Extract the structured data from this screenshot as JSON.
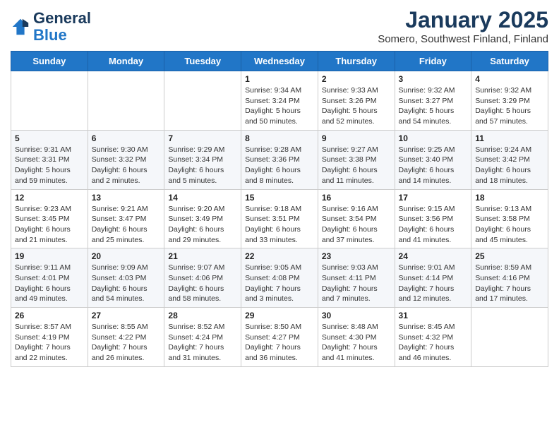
{
  "header": {
    "logo_general": "General",
    "logo_blue": "Blue",
    "title": "January 2025",
    "subtitle": "Somero, Southwest Finland, Finland"
  },
  "weekdays": [
    "Sunday",
    "Monday",
    "Tuesday",
    "Wednesday",
    "Thursday",
    "Friday",
    "Saturday"
  ],
  "weeks": [
    [
      {
        "day": "",
        "info": ""
      },
      {
        "day": "",
        "info": ""
      },
      {
        "day": "",
        "info": ""
      },
      {
        "day": "1",
        "info": "Sunrise: 9:34 AM\nSunset: 3:24 PM\nDaylight: 5 hours\nand 50 minutes."
      },
      {
        "day": "2",
        "info": "Sunrise: 9:33 AM\nSunset: 3:26 PM\nDaylight: 5 hours\nand 52 minutes."
      },
      {
        "day": "3",
        "info": "Sunrise: 9:32 AM\nSunset: 3:27 PM\nDaylight: 5 hours\nand 54 minutes."
      },
      {
        "day": "4",
        "info": "Sunrise: 9:32 AM\nSunset: 3:29 PM\nDaylight: 5 hours\nand 57 minutes."
      }
    ],
    [
      {
        "day": "5",
        "info": "Sunrise: 9:31 AM\nSunset: 3:31 PM\nDaylight: 5 hours\nand 59 minutes."
      },
      {
        "day": "6",
        "info": "Sunrise: 9:30 AM\nSunset: 3:32 PM\nDaylight: 6 hours\nand 2 minutes."
      },
      {
        "day": "7",
        "info": "Sunrise: 9:29 AM\nSunset: 3:34 PM\nDaylight: 6 hours\nand 5 minutes."
      },
      {
        "day": "8",
        "info": "Sunrise: 9:28 AM\nSunset: 3:36 PM\nDaylight: 6 hours\nand 8 minutes."
      },
      {
        "day": "9",
        "info": "Sunrise: 9:27 AM\nSunset: 3:38 PM\nDaylight: 6 hours\nand 11 minutes."
      },
      {
        "day": "10",
        "info": "Sunrise: 9:25 AM\nSunset: 3:40 PM\nDaylight: 6 hours\nand 14 minutes."
      },
      {
        "day": "11",
        "info": "Sunrise: 9:24 AM\nSunset: 3:42 PM\nDaylight: 6 hours\nand 18 minutes."
      }
    ],
    [
      {
        "day": "12",
        "info": "Sunrise: 9:23 AM\nSunset: 3:45 PM\nDaylight: 6 hours\nand 21 minutes."
      },
      {
        "day": "13",
        "info": "Sunrise: 9:21 AM\nSunset: 3:47 PM\nDaylight: 6 hours\nand 25 minutes."
      },
      {
        "day": "14",
        "info": "Sunrise: 9:20 AM\nSunset: 3:49 PM\nDaylight: 6 hours\nand 29 minutes."
      },
      {
        "day": "15",
        "info": "Sunrise: 9:18 AM\nSunset: 3:51 PM\nDaylight: 6 hours\nand 33 minutes."
      },
      {
        "day": "16",
        "info": "Sunrise: 9:16 AM\nSunset: 3:54 PM\nDaylight: 6 hours\nand 37 minutes."
      },
      {
        "day": "17",
        "info": "Sunrise: 9:15 AM\nSunset: 3:56 PM\nDaylight: 6 hours\nand 41 minutes."
      },
      {
        "day": "18",
        "info": "Sunrise: 9:13 AM\nSunset: 3:58 PM\nDaylight: 6 hours\nand 45 minutes."
      }
    ],
    [
      {
        "day": "19",
        "info": "Sunrise: 9:11 AM\nSunset: 4:01 PM\nDaylight: 6 hours\nand 49 minutes."
      },
      {
        "day": "20",
        "info": "Sunrise: 9:09 AM\nSunset: 4:03 PM\nDaylight: 6 hours\nand 54 minutes."
      },
      {
        "day": "21",
        "info": "Sunrise: 9:07 AM\nSunset: 4:06 PM\nDaylight: 6 hours\nand 58 minutes."
      },
      {
        "day": "22",
        "info": "Sunrise: 9:05 AM\nSunset: 4:08 PM\nDaylight: 7 hours\nand 3 minutes."
      },
      {
        "day": "23",
        "info": "Sunrise: 9:03 AM\nSunset: 4:11 PM\nDaylight: 7 hours\nand 7 minutes."
      },
      {
        "day": "24",
        "info": "Sunrise: 9:01 AM\nSunset: 4:14 PM\nDaylight: 7 hours\nand 12 minutes."
      },
      {
        "day": "25",
        "info": "Sunrise: 8:59 AM\nSunset: 4:16 PM\nDaylight: 7 hours\nand 17 minutes."
      }
    ],
    [
      {
        "day": "26",
        "info": "Sunrise: 8:57 AM\nSunset: 4:19 PM\nDaylight: 7 hours\nand 22 minutes."
      },
      {
        "day": "27",
        "info": "Sunrise: 8:55 AM\nSunset: 4:22 PM\nDaylight: 7 hours\nand 26 minutes."
      },
      {
        "day": "28",
        "info": "Sunrise: 8:52 AM\nSunset: 4:24 PM\nDaylight: 7 hours\nand 31 minutes."
      },
      {
        "day": "29",
        "info": "Sunrise: 8:50 AM\nSunset: 4:27 PM\nDaylight: 7 hours\nand 36 minutes."
      },
      {
        "day": "30",
        "info": "Sunrise: 8:48 AM\nSunset: 4:30 PM\nDaylight: 7 hours\nand 41 minutes."
      },
      {
        "day": "31",
        "info": "Sunrise: 8:45 AM\nSunset: 4:32 PM\nDaylight: 7 hours\nand 46 minutes."
      },
      {
        "day": "",
        "info": ""
      }
    ]
  ]
}
